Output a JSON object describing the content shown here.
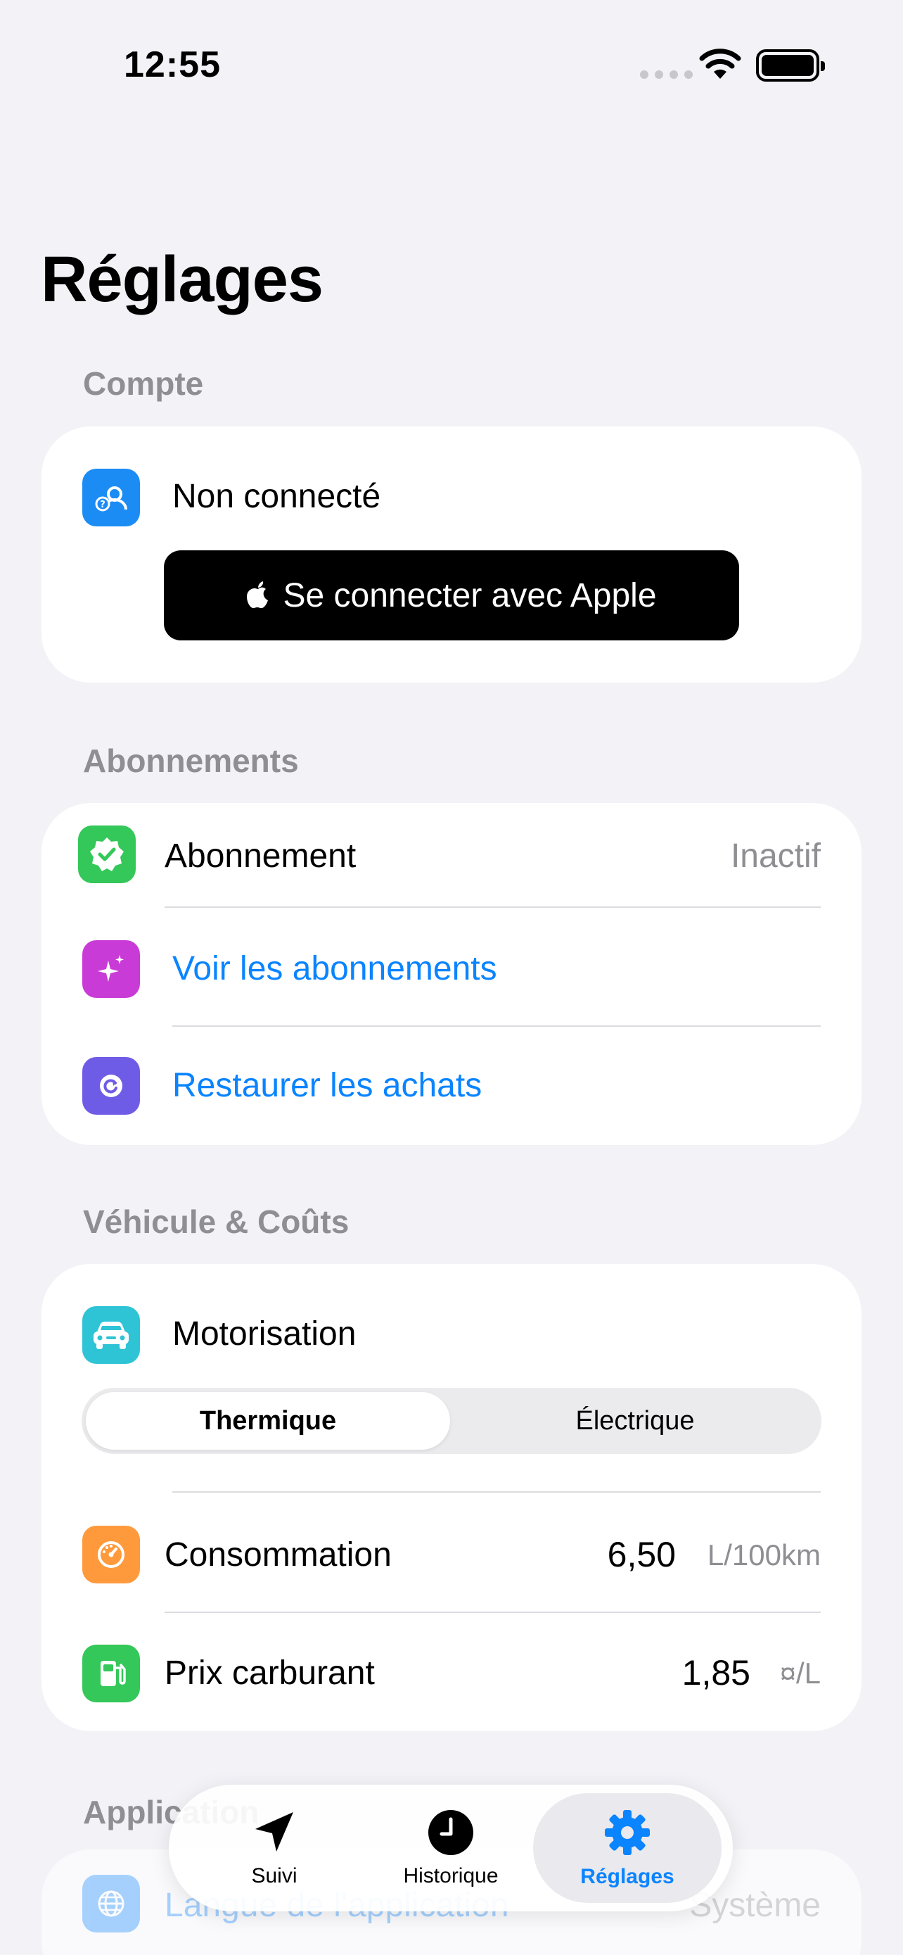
{
  "status_bar": {
    "time": "12:55"
  },
  "page": {
    "title": "Réglages"
  },
  "sections": {
    "account": {
      "header": "Compte",
      "status_label": "Non connecté",
      "apple_button_label": "Se connecter avec Apple"
    },
    "subscriptions": {
      "header": "Abonnements",
      "subscription_label": "Abonnement",
      "subscription_value": "Inactif",
      "view_label": "Voir les abonnements",
      "restore_label": "Restaurer les achats"
    },
    "vehicle": {
      "header": "Véhicule & Coûts",
      "engine_label": "Motorisation",
      "engine_options": [
        "Thermique",
        "Électrique"
      ],
      "engine_selected": "Thermique",
      "consumption_label": "Consommation",
      "consumption_value": "6,50",
      "consumption_unit": "L/100km",
      "fuel_price_label": "Prix carburant",
      "fuel_price_value": "1,85",
      "fuel_price_unit": "¤/L"
    },
    "app": {
      "header": "Application",
      "language_label": "Langue de l'application",
      "language_value": "Système"
    }
  },
  "tabbar": {
    "tabs": [
      {
        "label": "Suivi",
        "icon": "location-arrow-icon"
      },
      {
        "label": "Historique",
        "icon": "clock-icon"
      },
      {
        "label": "Réglages",
        "icon": "gear-icon"
      }
    ],
    "active": "Réglages"
  },
  "colors": {
    "accent": "#0a84ff",
    "background": "#f2f2f7",
    "secondary_text": "#8e8e93"
  }
}
